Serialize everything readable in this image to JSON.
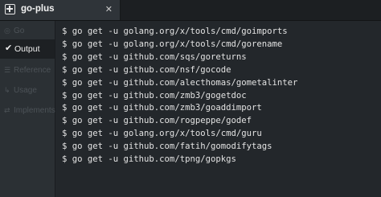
{
  "tab": {
    "title": "go-plus",
    "close_glyph": "✕",
    "icon": "plus-square-icon"
  },
  "sidebar": {
    "items": [
      {
        "label": "Go",
        "icon": "go-icon",
        "active": false
      },
      {
        "label": "Output",
        "icon": "checkmark-icon",
        "active": true
      },
      {
        "label": "Reference",
        "icon": "reference-icon",
        "active": false
      },
      {
        "label": "Usage",
        "icon": "usage-icon",
        "active": false
      },
      {
        "label": "Implements",
        "icon": "implements-icon",
        "active": false
      }
    ]
  },
  "output": {
    "lines": [
      "$ go get -u golang.org/x/tools/cmd/goimports",
      "$ go get -u golang.org/x/tools/cmd/gorename",
      "$ go get -u github.com/sqs/goreturns",
      "$ go get -u github.com/nsf/gocode",
      "$ go get -u github.com/alecthomas/gometalinter",
      "$ go get -u github.com/zmb3/gogetdoc",
      "$ go get -u github.com/zmb3/goaddimport",
      "$ go get -u github.com/rogpeppe/godef",
      "$ go get -u golang.org/x/tools/cmd/guru",
      "$ go get -u github.com/fatih/gomodifytags",
      "$ go get -u github.com/tpng/gopkgs"
    ]
  },
  "colors": {
    "background": "#23272b",
    "sidebar": "#2b3034",
    "text": "#e3e3e3",
    "inactive_text": "#4c5257"
  }
}
